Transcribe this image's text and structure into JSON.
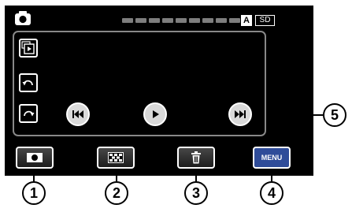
{
  "status": {
    "mode_badge": "A",
    "media_badge": "SD"
  },
  "icons": {
    "camera": "camera-icon",
    "index_playback": "index-playback-icon",
    "rotate_left": "rotate-left-icon",
    "rotate_right": "rotate-right-icon",
    "skip_back": "skip-back-icon",
    "play": "play-icon",
    "skip_forward": "skip-forward-icon",
    "record": "record-icon",
    "thumbnail": "thumbnail-grid-icon",
    "delete": "trash-icon"
  },
  "bottom_bar": {
    "menu_label": "MENU"
  },
  "callouts": [
    "1",
    "2",
    "3",
    "4",
    "5"
  ],
  "colors": {
    "screen": "#000000",
    "menu_button": "#2f4c99",
    "media_button": "#d9d9d9",
    "panel_border": "#888888"
  }
}
